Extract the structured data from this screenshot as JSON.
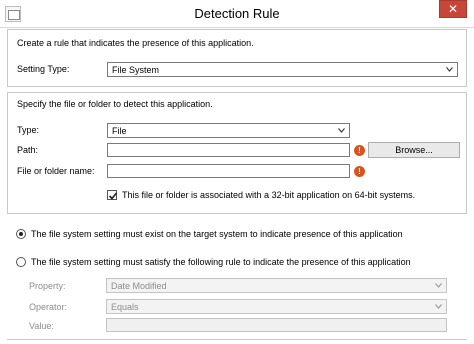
{
  "window": {
    "title": "Detection Rule",
    "close_label": "✕"
  },
  "general": {
    "intro_text": "Create a rule that indicates the presence of this application.",
    "setting_type_label": "Setting Type:",
    "setting_type_value": "File System"
  },
  "detect": {
    "intro_text": "Specify the file or folder to detect this application.",
    "type_label": "Type:",
    "type_value": "File",
    "path_label": "Path:",
    "path_value": "",
    "browse_label": "Browse...",
    "name_label": "File or folder name:",
    "name_value": "",
    "error_glyph": "!",
    "checkbox_label": "This file or folder is associated with a 32-bit application on 64-bit systems.",
    "checkbox_checked": true
  },
  "rule": {
    "option_exist_label": "The file system setting must exist on the target system to indicate presence of this application",
    "option_exist_selected": true,
    "option_satisfy_label": "The file system setting must satisfy the following rule to indicate the presence of this application",
    "option_satisfy_selected": false,
    "property_label": "Property:",
    "property_value": "Date Modified",
    "operator_label": "Operator:",
    "operator_value": "Equals",
    "value_label": "Value:",
    "value_value": ""
  },
  "colors": {
    "close_button": "#c7463b",
    "error_icon": "#d8541f",
    "section_border": "#c9c9c9"
  }
}
